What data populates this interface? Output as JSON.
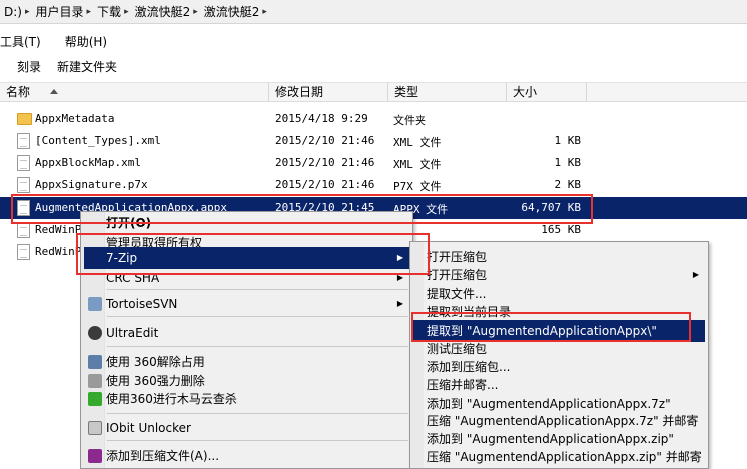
{
  "address": {
    "crumbs": [
      "D:)",
      "用户目录",
      "下载",
      "激流快艇2",
      "激流快艇2"
    ]
  },
  "menubar": {
    "items": [
      "工具(T)",
      "帮助(H)"
    ]
  },
  "toolbar": {
    "burn": "刻录",
    "new_folder": "新建文件夹"
  },
  "columns": {
    "name": "名称",
    "date": "修改日期",
    "type": "类型",
    "size": "大小"
  },
  "files": [
    {
      "name": "AppxMetadata",
      "date": "2015/4/18 9:29",
      "type": "文件夹",
      "size": "",
      "icon": "folder-icon"
    },
    {
      "name": "[Content_Types].xml",
      "date": "2015/2/10 21:46",
      "type": "XML 文件",
      "size": "1 KB",
      "icon": "file-icon"
    },
    {
      "name": "AppxBlockMap.xml",
      "date": "2015/2/10 21:46",
      "type": "XML 文件",
      "size": "1 KB",
      "icon": "file-icon"
    },
    {
      "name": "AppxSignature.p7x",
      "date": "2015/2/10 21:46",
      "type": "P7X 文件",
      "size": "2 KB",
      "icon": "file-icon"
    },
    {
      "name": "AugmentedApplicationAppx.appx",
      "date": "2015/2/10 21:45",
      "type": "APPX 文件",
      "size": "64,707 KB",
      "icon": "file-icon"
    },
    {
      "name": "RedWinPh",
      "date": "",
      "type": "",
      "size": "165 KB",
      "icon": "file-icon"
    },
    {
      "name": "RedWinPh",
      "date": "",
      "type": "",
      "size": "",
      "icon": "file-icon"
    }
  ],
  "context_menu": {
    "open": "打开(O)",
    "take_ownership": "管理员取得所有权",
    "sevenzip": "7-Zip",
    "crc_sha": "CRC SHA",
    "tortoise": "TortoiseSVN",
    "ultraedit": "UltraEdit",
    "unlock360": "使用 360解除占用",
    "delete360": "使用 360强力删除",
    "scan360": "使用360进行木马云查杀",
    "iobit": "IObit Unlocker",
    "add_archive": "添加到压缩文件(A)..."
  },
  "submenu_7zip": [
    "打开压缩包",
    "打开压缩包",
    "提取文件...",
    "提取到当前目录",
    "提取到 \"AugmentendApplicationAppx\\\"",
    "测试压缩包",
    "添加到压缩包...",
    "压缩并邮寄...",
    "添加到 \"AugmentendApplicationAppx.7z\"",
    "压缩 \"AugmentendApplicationAppx.7z\" 并邮寄",
    "添加到 \"AugmentendApplicationAppx.zip\"",
    "压缩 \"AugmentendApplicationAppx.zip\" 并邮寄"
  ],
  "colors": {
    "selection": "#0a246a",
    "highlight_box": "#e8302c",
    "folder": "#f2c34d"
  }
}
